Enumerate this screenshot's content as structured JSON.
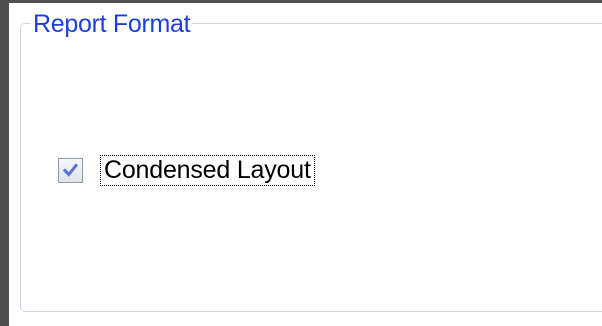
{
  "report_format": {
    "title": "Report Format",
    "condensed_layout": {
      "label": "Condensed Layout",
      "checked": true
    }
  },
  "colors": {
    "group_title": "#1c3fd8",
    "group_border": "#cfd6e1",
    "check_mark": "#5b6fd8"
  }
}
